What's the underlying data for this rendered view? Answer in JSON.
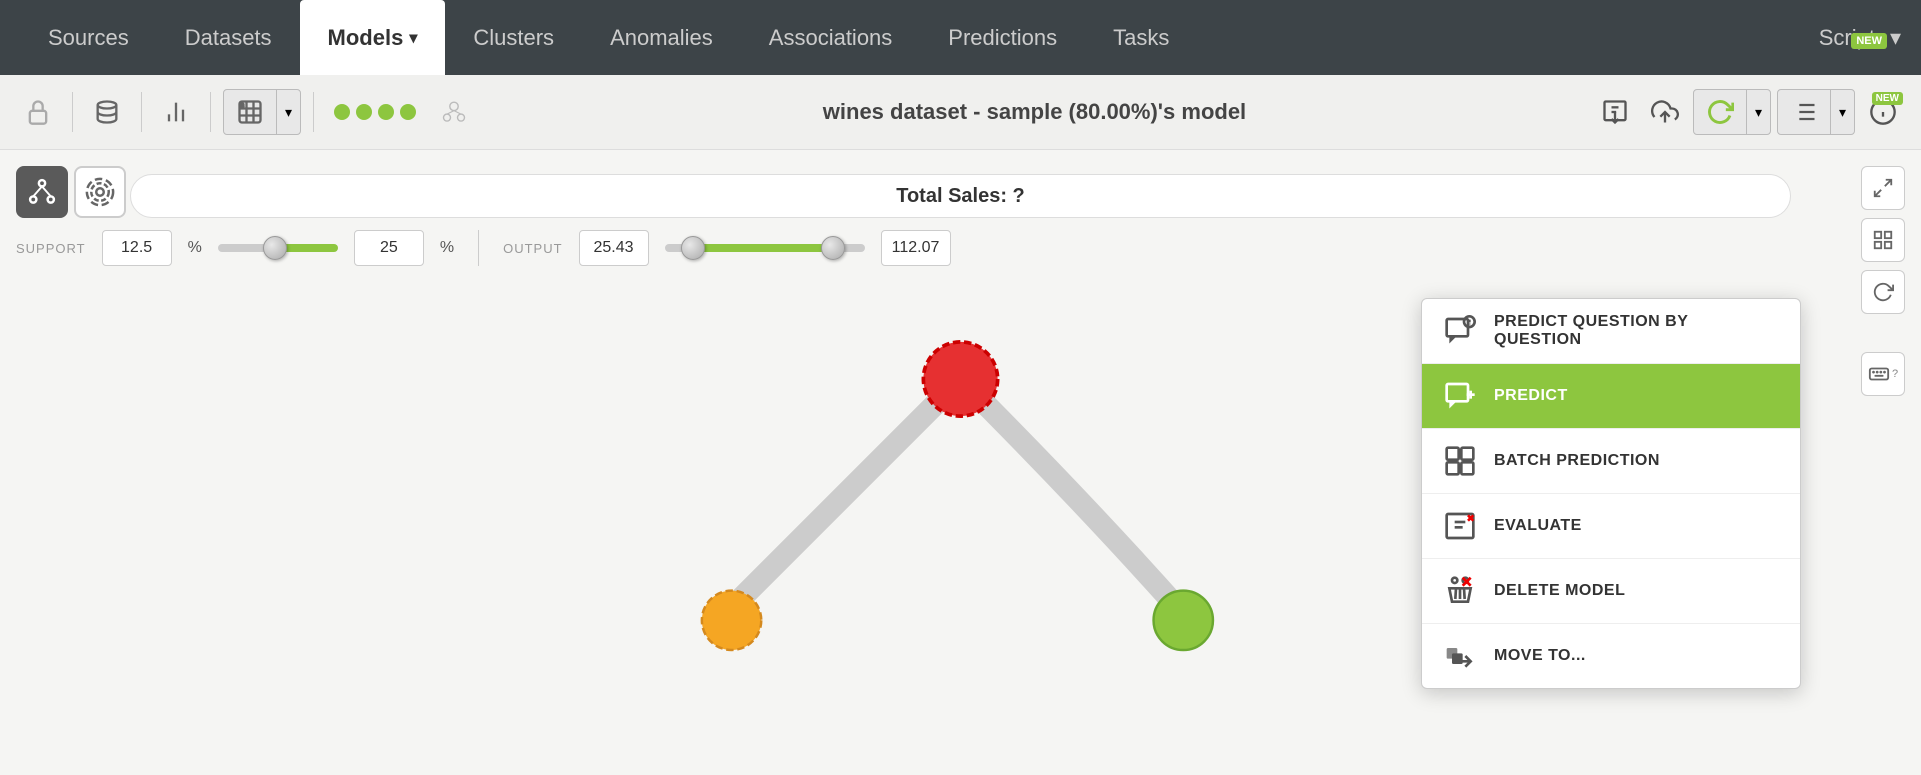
{
  "navbar": {
    "items": [
      {
        "id": "sources",
        "label": "Sources",
        "active": false
      },
      {
        "id": "datasets",
        "label": "Datasets",
        "active": false
      },
      {
        "id": "models",
        "label": "Models",
        "active": true,
        "hasDropdown": true
      },
      {
        "id": "clusters",
        "label": "Clusters",
        "active": false
      },
      {
        "id": "anomalies",
        "label": "Anomalies",
        "active": false
      },
      {
        "id": "associations",
        "label": "Associations",
        "active": false
      },
      {
        "id": "predictions",
        "label": "Predictions",
        "active": false
      },
      {
        "id": "tasks",
        "label": "Tasks",
        "active": false
      }
    ],
    "scripts_label": "Scripts",
    "new_badge": "NEW"
  },
  "toolbar": {
    "title": "wines dataset - sample (80.00%)'s model",
    "new_badge": "NEW",
    "dots_count": 4
  },
  "controls": {
    "support_label": "SUPPORT",
    "output_label": "OUTPUT",
    "support_min_value": "12.5",
    "support_pct": "%",
    "support_slider_value": "25",
    "support_slider_pct": "%",
    "output_min_value": "25.43",
    "output_max_value": "112.07"
  },
  "main": {
    "search_text": "Total Sales: ?"
  },
  "dropdown": {
    "items": [
      {
        "id": "predict-question",
        "label": "PREDICT QUESTION BY QUESTION",
        "icon": "❓📋",
        "highlighted": false
      },
      {
        "id": "predict",
        "label": "PREDICT",
        "icon": "📋➕",
        "highlighted": true
      },
      {
        "id": "batch-prediction",
        "label": "BATCH PREDICTION",
        "icon": "🔲",
        "highlighted": false
      },
      {
        "id": "evaluate",
        "label": "EVALUATE",
        "icon": "📊➕",
        "highlighted": false
      },
      {
        "id": "delete-model",
        "label": "DELETE MODEL",
        "icon": "🗑️",
        "highlighted": false
      },
      {
        "id": "move-to",
        "label": "MOVE TO...",
        "icon": "📁",
        "highlighted": false
      }
    ]
  },
  "tree": {
    "node_root_color": "#e63031",
    "node_left_color": "#f5a623",
    "node_right_color": "#8dc63f"
  }
}
